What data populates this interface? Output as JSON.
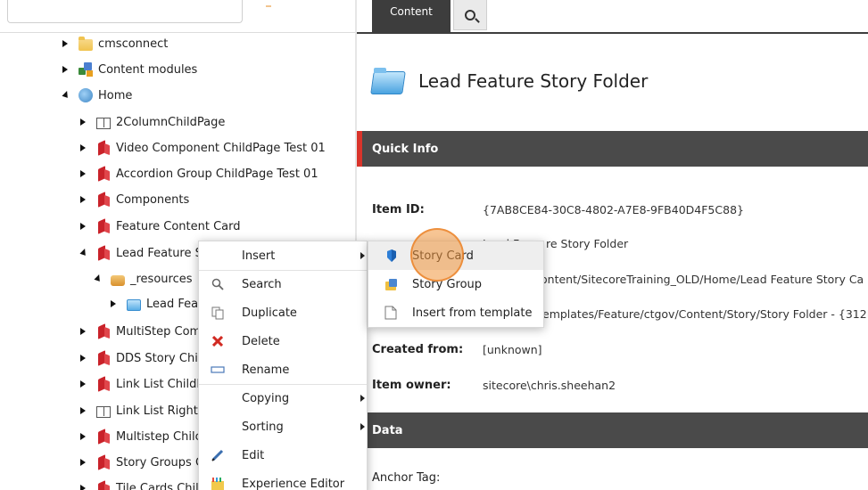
{
  "tree": {
    "items": [
      {
        "label": "cmsconnect",
        "icon": "folder-icon",
        "expanded": false
      },
      {
        "label": "Content modules",
        "icon": "modules-icon",
        "expanded": false
      },
      {
        "label": "Home",
        "icon": "home-icon",
        "expanded": true
      },
      {
        "label": "2ColumnChildPage",
        "icon": "page-icon",
        "expanded": false
      },
      {
        "label": "Video Component ChildPage Test 01",
        "icon": "red-book-icon",
        "expanded": false
      },
      {
        "label": "Accordion Group ChildPage Test 01",
        "icon": "red-book-icon",
        "expanded": false
      },
      {
        "label": "Components",
        "icon": "red-book-icon",
        "expanded": false
      },
      {
        "label": "Feature Content Card",
        "icon": "red-book-icon",
        "expanded": false
      },
      {
        "label": "Lead Feature S",
        "icon": "red-book-icon",
        "expanded": true
      },
      {
        "label": "_resources",
        "icon": "resources-icon",
        "expanded": true
      },
      {
        "label": "Lead Fea",
        "icon": "blue-folder-icon",
        "expanded": false
      },
      {
        "label": "MultiStep Com",
        "icon": "red-book-icon",
        "expanded": false
      },
      {
        "label": "DDS Story Chil",
        "icon": "red-book-icon",
        "expanded": false
      },
      {
        "label": "Link List ChildF",
        "icon": "red-book-icon",
        "expanded": false
      },
      {
        "label": "Link List Right I",
        "icon": "page-icon",
        "expanded": false
      },
      {
        "label": "Multistep Chilc",
        "icon": "red-book-icon",
        "expanded": false
      },
      {
        "label": "Story Groups C",
        "icon": "red-book-icon",
        "expanded": false
      },
      {
        "label": "Tile Cards Chilc",
        "icon": "red-book-icon",
        "expanded": false
      }
    ]
  },
  "content": {
    "tab_content_label": "Content",
    "item_title": "Lead Feature Story Folder",
    "quick_info_label": "Quick Info",
    "data_label": "Data",
    "fields": [
      {
        "label": "Item ID:",
        "value": "{7AB8CE84-30C8-4802-A7E8-9FB40D4F5C88}"
      },
      {
        "label": "",
        "value": "re Story Folder"
      },
      {
        "label": "",
        "value": "ontent/SitecoreTraining_OLD/Home/Lead Feature Story Ca"
      },
      {
        "label": "",
        "value": "emplates/Feature/ctgov/Content/Story/Story Folder - {312I"
      },
      {
        "label": "Created from:",
        "value": "[unknown]"
      },
      {
        "label": "Item owner:",
        "value": "sitecore\\chris.sheehan2"
      }
    ],
    "value_fragment": "Lead F",
    "anchor_tag_label": "Anchor Tag:"
  },
  "context_menu": {
    "items": [
      {
        "label": "Insert",
        "icon": "",
        "has_submenu": true
      },
      {
        "label": "Search",
        "icon": "search-icon",
        "has_submenu": false
      },
      {
        "label": "Duplicate",
        "icon": "duplicate-icon",
        "has_submenu": false
      },
      {
        "label": "Delete",
        "icon": "delete-icon",
        "has_submenu": false
      },
      {
        "label": "Rename",
        "icon": "rename-icon",
        "has_submenu": false
      },
      {
        "label": "Copying",
        "icon": "",
        "has_submenu": true
      },
      {
        "label": "Sorting",
        "icon": "",
        "has_submenu": true
      },
      {
        "label": "Edit",
        "icon": "edit-icon",
        "has_submenu": false
      },
      {
        "label": "Experience Editor",
        "icon": "experience-editor-icon",
        "has_submenu": false
      }
    ]
  },
  "insert_submenu": {
    "items": [
      {
        "label": "Story Card",
        "icon": "story-card-icon",
        "hovered": true
      },
      {
        "label": "Story Group",
        "icon": "story-group-icon",
        "hovered": false
      },
      {
        "label": "Insert from template",
        "icon": "template-icon",
        "hovered": false
      }
    ]
  },
  "colors": {
    "accent_red": "#d9342b",
    "section_bar": "#4a4a4a",
    "click_highlight": "#f0963c"
  }
}
